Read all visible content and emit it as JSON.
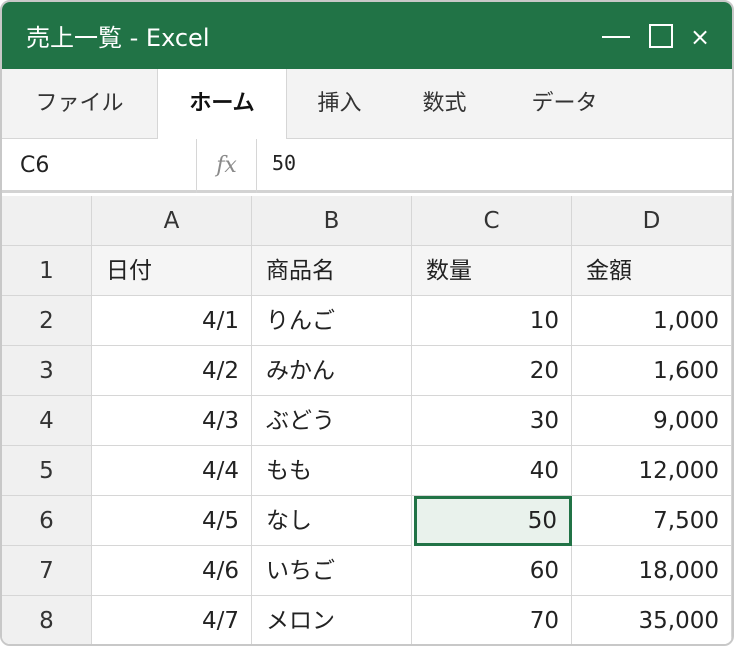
{
  "window": {
    "title": "売上一覧 - Excel",
    "close_glyph": "×"
  },
  "ribbon": {
    "tabs": [
      "ファイル",
      "ホーム",
      "挿入",
      "数式",
      "データ"
    ],
    "active_tab": "ホーム"
  },
  "formula_bar": {
    "name_box": "C6",
    "fx_label": "fx",
    "value": "50"
  },
  "sheet": {
    "columns": [
      "A",
      "B",
      "C",
      "D"
    ],
    "rows": [
      {
        "num": "1",
        "a": "日付",
        "b": "商品名",
        "c": "数量",
        "d": "金額"
      },
      {
        "num": "2",
        "a": "4/1",
        "b": "りんご",
        "c": "10",
        "d": "1,000"
      },
      {
        "num": "3",
        "a": "4/2",
        "b": "みかん",
        "c": "20",
        "d": "1,600"
      },
      {
        "num": "4",
        "a": "4/3",
        "b": "ぶどう",
        "c": "30",
        "d": "9,000"
      },
      {
        "num": "5",
        "a": "4/4",
        "b": "もも",
        "c": "40",
        "d": "12,000"
      },
      {
        "num": "6",
        "a": "4/5",
        "b": "なし",
        "c": "50",
        "d": "7,500"
      },
      {
        "num": "7",
        "a": "4/6",
        "b": "いちご",
        "c": "60",
        "d": "18,000"
      },
      {
        "num": "8",
        "a": "4/7",
        "b": "メロン",
        "c": "70",
        "d": "35,000"
      }
    ],
    "selected_cell": "C6"
  },
  "colors": {
    "accent": "#217346",
    "selected_fill": "#e9f2ec",
    "header_fill": "#f0f0f0"
  }
}
